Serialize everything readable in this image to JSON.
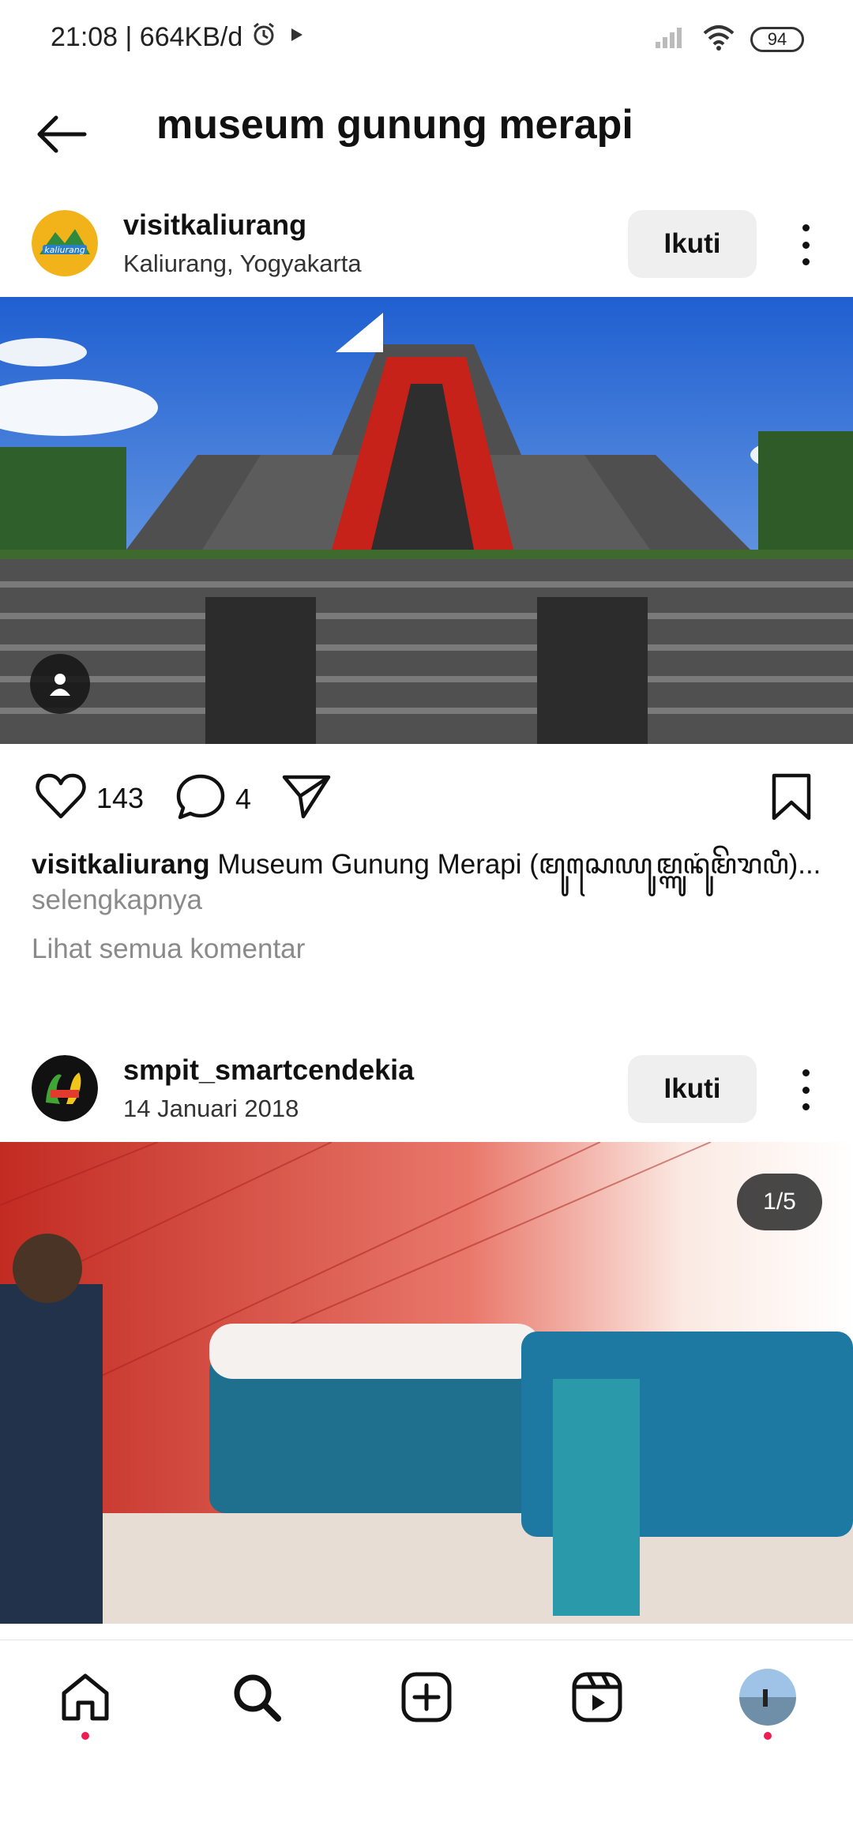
{
  "status_bar": {
    "time_speed": "21:08 | 664KB/d",
    "battery": "94"
  },
  "header": {
    "title": "museum gunung merapi"
  },
  "post1": {
    "username": "visitkaliurang",
    "location": "Kaliurang, Yogyakarta",
    "follow_label": "Ikuti",
    "likes": "143",
    "comments": "4",
    "caption_user": "visitkaliurang",
    "caption_text": " Museum Gunung Merapi (ꦩꦸꦱꦺꦪꦸꦩ꧀ꦒꦸꦤꦸꦁꦩꦼꦫꦥꦶ)...",
    "more_label": "selengkapnya",
    "view_comments_label": "Lihat semua komentar"
  },
  "post2": {
    "username": "smpit_smartcendekia",
    "date": "14 Januari 2018",
    "follow_label": "Ikuti",
    "page_indicator": "1/5"
  },
  "icons": [
    "back-arrow-icon",
    "more-icon",
    "heart-icon",
    "comment-icon",
    "share-icon",
    "bookmark-icon",
    "user-tag-icon",
    "home-icon",
    "search-icon",
    "add-icon",
    "reels-icon",
    "profile-avatar"
  ],
  "colors": {
    "notification_dot": "#ee1d52",
    "follow_button_bg": "#efefef",
    "muted_text": "#8a8a8a"
  }
}
